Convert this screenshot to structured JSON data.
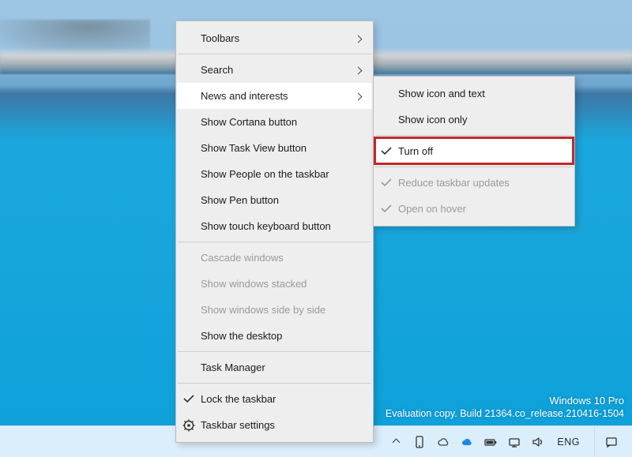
{
  "watermark": {
    "line1": "Windows 10 Pro",
    "line2": "Evaluation copy. Build 21364.co_release.210416-1504"
  },
  "tray": {
    "lang": "ENG",
    "icons": [
      "more",
      "phone",
      "cloud-outline",
      "onedrive",
      "battery",
      "network",
      "volume"
    ]
  },
  "menu_main": [
    {
      "label": "Toolbars",
      "submenu": true
    },
    {
      "sep": true
    },
    {
      "label": "Search",
      "submenu": true
    },
    {
      "label": "News and interests",
      "submenu": true,
      "hover": true
    },
    {
      "label": "Show Cortana button"
    },
    {
      "label": "Show Task View button"
    },
    {
      "label": "Show People on the taskbar"
    },
    {
      "label": "Show Pen button"
    },
    {
      "label": "Show touch keyboard button"
    },
    {
      "sep": true
    },
    {
      "label": "Cascade windows",
      "disabled": true
    },
    {
      "label": "Show windows stacked",
      "disabled": true
    },
    {
      "label": "Show windows side by side",
      "disabled": true
    },
    {
      "label": "Show the desktop"
    },
    {
      "sep": true
    },
    {
      "label": "Task Manager"
    },
    {
      "sep": true
    },
    {
      "label": "Lock the taskbar",
      "checked": true
    },
    {
      "label": "Taskbar settings",
      "icon": "gear"
    }
  ],
  "menu_sub": [
    {
      "label": "Show icon and text"
    },
    {
      "label": "Show icon only"
    },
    {
      "sep": true
    },
    {
      "label": "Turn off",
      "checked": true,
      "hover": true,
      "highlight": true
    },
    {
      "sep": true
    },
    {
      "label": "Reduce taskbar updates",
      "checked": true,
      "disabled": true
    },
    {
      "label": "Open on hover",
      "checked": true,
      "disabled": true
    }
  ]
}
